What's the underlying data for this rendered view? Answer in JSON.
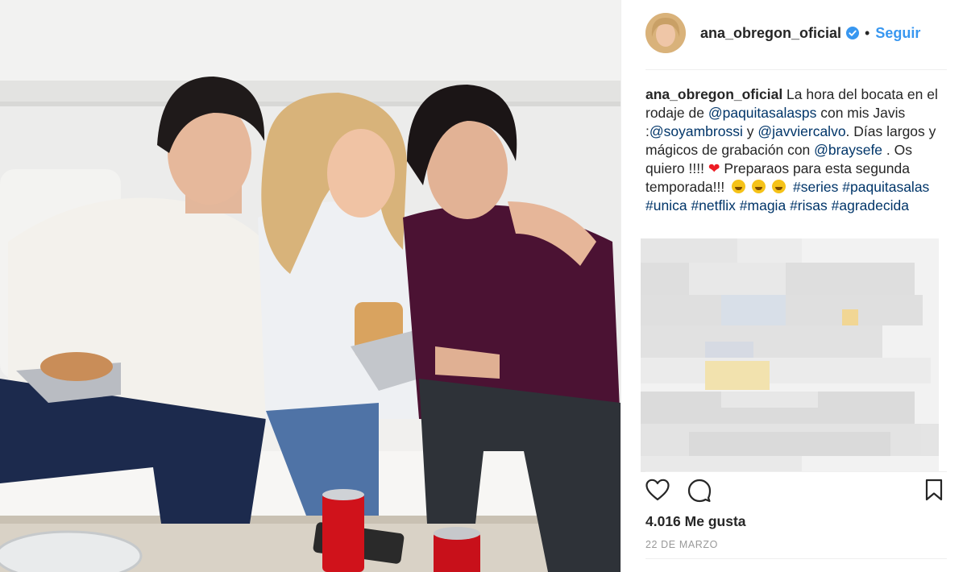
{
  "post": {
    "username": "ana_obregon_oficial",
    "follow_label": "Seguir",
    "separator": "•",
    "caption": {
      "username": "ana_obregon_oficial",
      "t1": " La hora del bocata en el rodaje de ",
      "mention1": "@paquitasalasps",
      "t2": " con mis Javis :",
      "mention2": "@soyambrossi",
      "t3": " y ",
      "mention3": "@javviercalvo",
      "t4": ". Días largos y mágicos de grabación con ",
      "mention4": "@braysefe",
      "t5": " . Os quiero !!!! ",
      "t6": "  Preparaos para esta segunda temporada!!! ",
      "hashtag1": "#series",
      "hashtag2": "#paquitasalas",
      "hashtag3": "#unica",
      "hashtag4": "#netflix",
      "hashtag5": "#magia",
      "hashtag6": "#risas",
      "hashtag7": "#agradecida"
    },
    "heart_emoji": "❤",
    "likes": "4.016 Me gusta",
    "date": "22 DE MARZO"
  },
  "icons": [
    "verified-icon",
    "like-heart-icon",
    "comment-icon",
    "bookmark-icon"
  ],
  "colors": {
    "accent": "#3897f0",
    "hashtag": "#003569",
    "text": "#262626",
    "muted": "#999999"
  }
}
